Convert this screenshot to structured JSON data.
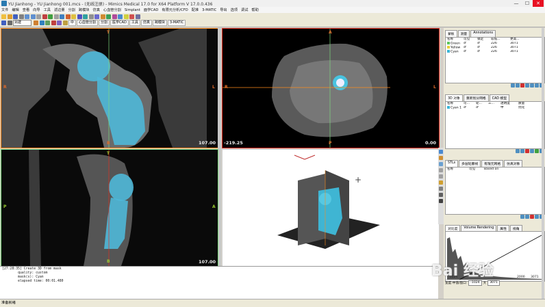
{
  "window": {
    "title": "YU Jianhong - YU Jianhong 001.mcs - (无线注册) - Mimics Medical 17.0 for X64 Platform V 17.0.0.436",
    "minimize": "—",
    "maximize": "☐",
    "close": "✕"
  },
  "menu": [
    "文件",
    "编辑",
    "查看",
    "向导",
    "工具",
    "滤边量",
    "分割",
    "跨模块",
    "仿真",
    "心血管分割",
    "Simplant",
    "面学CAD",
    "有限元分析/CFD",
    "配准",
    "3-MATIC",
    "导出",
    "选项",
    "调试",
    "帮助"
  ],
  "toolbar": {
    "select_value": "另建",
    "tabs": [
      "中",
      "心血管分割",
      "分割",
      "医学CAD",
      "工具",
      "仿真",
      "跨模块",
      "3-MATIC"
    ]
  },
  "viewports": {
    "coronal": {
      "top": "T",
      "bottom": "B",
      "left": "R",
      "right": "L",
      "value": "107.00"
    },
    "axial": {
      "top": "A",
      "bottom": "P",
      "left": "R",
      "right": "L",
      "value_left": "-219.25",
      "value_right": "0.00"
    },
    "sagittal": {
      "top": "T",
      "bottom": "B",
      "left": "P",
      "right": "A",
      "value": "107.00"
    },
    "view3d": {
      "cursor": "+"
    }
  },
  "console": [
    "[27:28:35] Create 3D from mask",
    "        quality: custom",
    "        mask(s): Cyan",
    "        elapsed time: 00:01.480"
  ],
  "status": "准备就绪",
  "masks_panel": {
    "tabs": [
      "蒙板",
      "测量",
      "Annotations"
    ],
    "columns": [
      "名称",
      "可见",
      "锁定",
      "较低...",
      "更高..."
    ],
    "rows": [
      {
        "name": "Green",
        "color": "#5ec85e",
        "visible": "♂",
        "locked": "♂",
        "lower": "226",
        "upper": "3071"
      },
      {
        "name": "Yellow",
        "color": "#e8d23a",
        "visible": "♂",
        "locked": "♂",
        "lower": "226",
        "upper": "3071"
      },
      {
        "name": "Cyan",
        "color": "#3ab6d8",
        "visible": "♂",
        "locked": "♂",
        "lower": "226",
        "upper": "3071"
      }
    ]
  },
  "objects3d_panel": {
    "tabs": [
      "3D 对象",
      "重新划分网格",
      "CAD 模型"
    ],
    "columns": [
      "名称",
      "可...",
      "轮...",
      "三...",
      "透明度",
      "质量"
    ],
    "rows": [
      {
        "name": "Cyan 1",
        "color": "#3ab6d8",
        "visible": "♂",
        "contour": "♂",
        "tri": "",
        "transparency": "中",
        "quality": "优化"
      }
    ]
  },
  "stl_panel": {
    "tabs": [
      "STLs",
      "多层轮廓线",
      "有限元网格",
      "仿真对象"
    ],
    "columns": [
      "名称",
      "可见",
      "Based on"
    ]
  },
  "histogram_panel": {
    "tabs": [
      "对比度",
      "Volume Rendering",
      "属性",
      "视角"
    ],
    "axis_min": "-1024",
    "axis_max": "3071",
    "mid_label": "2000",
    "footer_label1": "宽度:",
    "footer_label2": "中值/窗口:",
    "footer_value1": "-1024",
    "footer_label3": "大",
    "footer_value2": "3071"
  },
  "watermark": "Bai 经验"
}
